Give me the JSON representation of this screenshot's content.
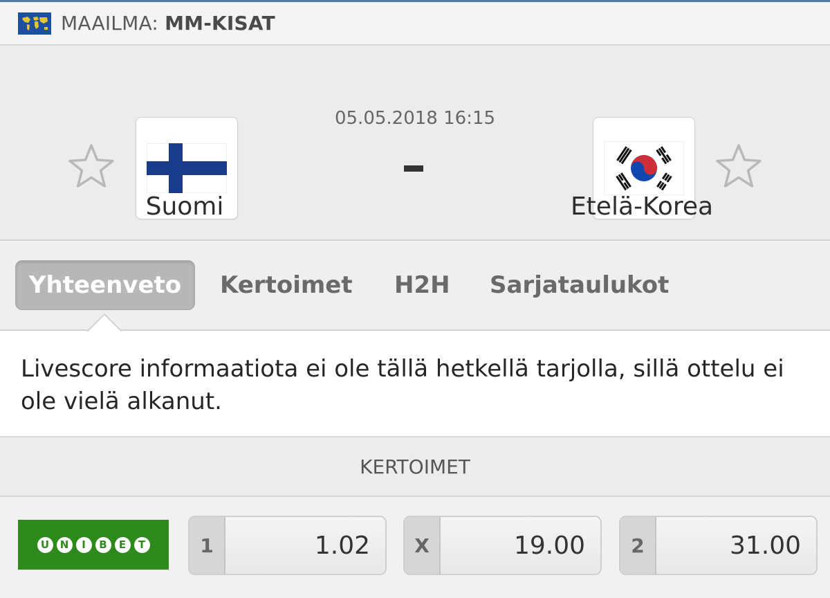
{
  "breadcrumb": {
    "region": "MAAILMA:",
    "competition": "MM-KISAT"
  },
  "match": {
    "datetime": "05.05.2018 16:15",
    "score": "-",
    "home": {
      "name": "Suomi",
      "flag": "finland-flag"
    },
    "away": {
      "name": "Etelä-Korea",
      "flag": "south-korea-flag"
    }
  },
  "tabs": [
    {
      "label": "Yhteenveto",
      "active": true
    },
    {
      "label": "Kertoimet",
      "active": false
    },
    {
      "label": "H2H",
      "active": false
    },
    {
      "label": "Sarjataulukot",
      "active": false
    }
  ],
  "info": {
    "message": "Livescore informaatiota ei ole tällä hetkellä tarjolla, sillä ottelu ei ole vielä alkanut."
  },
  "odds": {
    "header": "KERTOIMET",
    "bookmaker": "UNIBET",
    "bookmaker_letters": [
      "U",
      "N",
      "I",
      "B",
      "E",
      "T"
    ],
    "items": [
      {
        "label": "1",
        "value": "1.02"
      },
      {
        "label": "X",
        "value": "19.00"
      },
      {
        "label": "2",
        "value": "31.00"
      }
    ]
  },
  "colors": {
    "unibet_green": "#2f8a1e",
    "finland_blue": "#1a3a8a",
    "korea_red": "#cd2e3a",
    "korea_blue": "#0f47af"
  }
}
